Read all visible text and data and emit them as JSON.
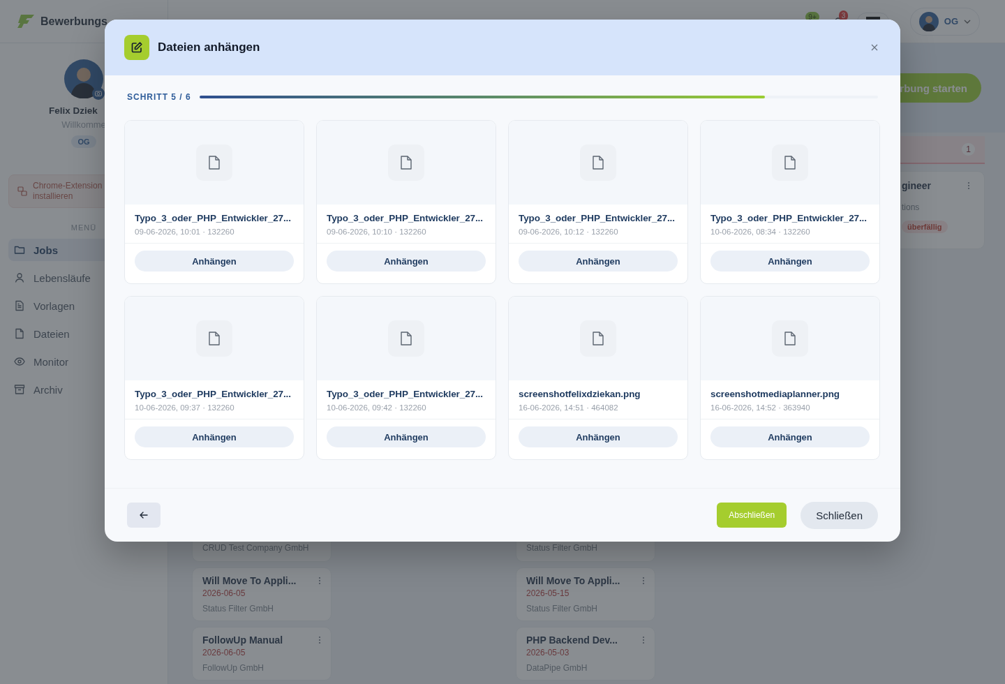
{
  "top_bar": {
    "logo_text": "Bewerbungs",
    "messages_badge": "9+",
    "alerts_badge": "3",
    "user_initials": "OG"
  },
  "sidebar": {
    "profile": {
      "name": "Felix Dziek",
      "greeting": "Willkomme",
      "initials": "OG"
    },
    "extension_banner": "Chrome-Extension installieren",
    "menu_heading": "MENÜ",
    "items": [
      {
        "label": "Jobs",
        "selected": true
      },
      {
        "label": "Lebensläufe",
        "selected": false
      },
      {
        "label": "Vorlagen",
        "selected": false
      },
      {
        "label": "Dateien",
        "selected": false
      },
      {
        "label": "Monitor",
        "selected": false
      },
      {
        "label": "Archiv",
        "selected": false
      }
    ]
  },
  "main": {
    "start_button": "rbung starten",
    "columns": [
      {
        "cards": [
          {
            "company": "CRUD Test Company GmbH"
          },
          {
            "title": "Will Move To Appli...",
            "date": "2026-06-05",
            "company": "Status Filter GmbH"
          },
          {
            "title": "FollowUp Manual",
            "date": "2026-06-05",
            "company": "FollowUp GmbH"
          }
        ]
      },
      {
        "cards": [
          {
            "company": "Status Filter GmbH"
          },
          {
            "title": "Will Move To Appli...",
            "date": "2026-05-15",
            "company": "Status Filter GmbH"
          },
          {
            "title": "PHP Backend Dev...",
            "date": "2026-05-03",
            "company": "DataPipe GmbH"
          }
        ]
      },
      {
        "count": "1",
        "cards": [
          {
            "title": "gineer",
            "company": "tions",
            "tag": "überfällig"
          }
        ]
      }
    ]
  },
  "modal": {
    "title": "Dateien anhängen",
    "step_label": "SCHRITT 5 / 6",
    "progress": {
      "level": 0.833
    },
    "files": [
      {
        "name": "Typo_3_oder_PHP_Entwickler_27...",
        "meta": "09-06-2026, 10:01 · 132260",
        "button": "Anhängen"
      },
      {
        "name": "Typo_3_oder_PHP_Entwickler_27...",
        "meta": "09-06-2026, 10:10 · 132260",
        "button": "Anhängen"
      },
      {
        "name": "Typo_3_oder_PHP_Entwickler_27...",
        "meta": "09-06-2026, 10:12 · 132260",
        "button": "Anhängen"
      },
      {
        "name": "Typo_3_oder_PHP_Entwickler_27...",
        "meta": "10-06-2026, 08:34 · 132260",
        "button": "Anhängen"
      },
      {
        "name": "Typo_3_oder_PHP_Entwickler_27...",
        "meta": "10-06-2026, 09:37 · 132260",
        "button": "Anhängen"
      },
      {
        "name": "Typo_3_oder_PHP_Entwickler_27...",
        "meta": "10-06-2026, 09:42 · 132260",
        "button": "Anhängen"
      },
      {
        "name": "screenshotfelixdziekan.png",
        "meta": "16-06-2026, 14:51 · 464082",
        "button": "Anhängen"
      },
      {
        "name": "screenshotmediaplanner.png",
        "meta": "16-06-2026, 14:52 · 363940",
        "button": "Anhängen"
      }
    ],
    "footer": {
      "finish": "Abschließen",
      "close": "Schließen"
    }
  }
}
